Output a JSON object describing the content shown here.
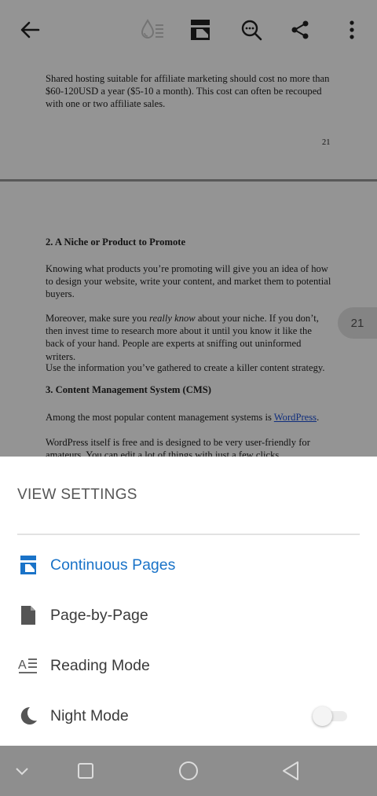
{
  "toolbar": {
    "back": "back-arrow-icon",
    "icons": [
      "reading-ink-icon",
      "view-mode-icon",
      "search-document-icon",
      "share-icon",
      "more-vert-icon"
    ]
  },
  "document": {
    "page21_tail": "Shared hosting suitable for affiliate marketing should cost no more than $60-120USD a year ($5-10 a month). This cost can often be recouped with one or two affiliate sales.",
    "page21_number": "21",
    "heading_niche": "2. A Niche or Product to Promote",
    "para_knowing": "Knowing what products you’re promoting will give you an idea of how to design your website, write your content, and market them to potential buyers.",
    "para_moreover_a": "Moreover, make sure you ",
    "para_moreover_em": "really know",
    "para_moreover_b": " about your niche. If you don’t, then invest time to research more about it until you know it like the back of your hand. People are experts at sniffing out uninformed writers.",
    "para_use": "Use the information you’ve gathered to create a killer content strategy.",
    "heading_cms": "3. Content Management System (CMS)",
    "para_among_a": "Among the most popular content management systems is ",
    "para_among_link": "WordPress",
    "para_among_b": ".",
    "para_wordpress": "WordPress itself is free and is designed to be very user-friendly for amateurs. You can edit a lot of things with just a few clicks.",
    "page_chip": "21"
  },
  "sheet": {
    "title": "VIEW SETTINGS",
    "options": [
      {
        "label": "Continuous Pages",
        "icon": "continuous-pages-icon",
        "active": true
      },
      {
        "label": "Page-by-Page",
        "icon": "single-page-icon",
        "active": false
      },
      {
        "label": "Reading Mode",
        "icon": "reading-mode-icon",
        "active": false
      },
      {
        "label": "Night Mode",
        "icon": "moon-icon",
        "active": false
      }
    ],
    "night_mode_on": false
  },
  "colors": {
    "accent": "#1a73c8",
    "scrim": "#000000",
    "navbar": "#8e8e8e"
  },
  "navbar": {
    "icons": [
      "collapse-chevron-icon",
      "recents-square-icon",
      "home-circle-icon",
      "back-triangle-icon"
    ]
  }
}
